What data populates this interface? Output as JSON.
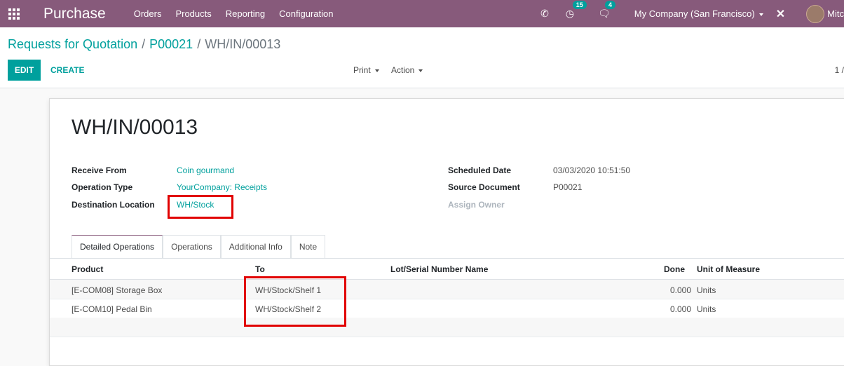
{
  "navbar": {
    "app_name": "Purchase",
    "menu": [
      "Orders",
      "Products",
      "Reporting",
      "Configuration"
    ],
    "activity_count": "15",
    "message_count": "4",
    "company": "My Company (San Francisco)",
    "user": "Mitc"
  },
  "control_panel": {
    "breadcrumb": [
      "Requests for Quotation",
      "P00021",
      "WH/IN/00013"
    ],
    "edit_label": "EDIT",
    "create_label": "CREATE",
    "print_label": "Print",
    "action_label": "Action",
    "pager": "1 /"
  },
  "record": {
    "title": "WH/IN/00013",
    "left_fields": [
      {
        "label": "Receive From",
        "value": "Coin gourmand"
      },
      {
        "label": "Operation Type",
        "value": "YourCompany: Receipts"
      },
      {
        "label": "Destination Location",
        "value": "WH/Stock"
      }
    ],
    "right_fields": [
      {
        "label": "Scheduled Date",
        "value": "03/03/2020 10:51:50"
      },
      {
        "label": "Source Document",
        "value": "P00021"
      },
      {
        "label": "Assign Owner",
        "value": ""
      }
    ]
  },
  "tabs": [
    "Detailed Operations",
    "Operations",
    "Additional Info",
    "Note"
  ],
  "table": {
    "columns": [
      "Product",
      "To",
      "Lot/Serial Number Name",
      "Done",
      "Unit of Measure"
    ],
    "rows": [
      [
        "[E-COM08] Storage Box",
        "WH/Stock/Shelf 1",
        "",
        "0.000",
        "Units"
      ],
      [
        "[E-COM10] Pedal Bin",
        "WH/Stock/Shelf 2",
        "",
        "0.000",
        "Units"
      ]
    ]
  },
  "colors": {
    "brand": "#875a7b",
    "accent": "#00a09d",
    "highlight": "#e10000"
  }
}
